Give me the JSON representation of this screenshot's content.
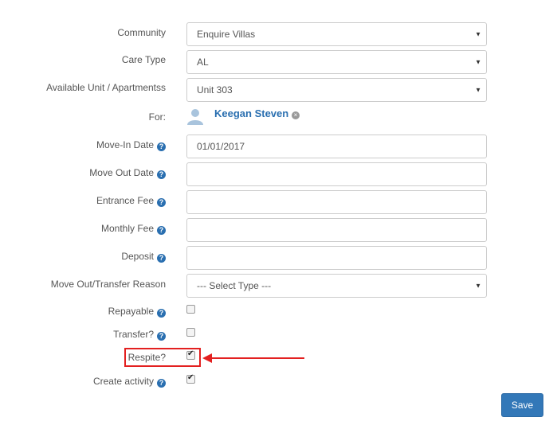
{
  "form": {
    "community": {
      "label": "Community",
      "value": "Enquire Villas"
    },
    "care_type": {
      "label": "Care Type",
      "value": "AL"
    },
    "unit": {
      "label": "Available Unit / Apartmentss",
      "value": "Unit 303"
    },
    "for": {
      "label": "For:",
      "name": "Keegan Steven"
    },
    "move_in_date": {
      "label": "Move-In Date",
      "value": "01/01/2017"
    },
    "move_out_date": {
      "label": "Move Out Date",
      "value": ""
    },
    "entrance_fee": {
      "label": "Entrance Fee",
      "value": ""
    },
    "monthly_fee": {
      "label": "Monthly Fee",
      "value": ""
    },
    "deposit": {
      "label": "Deposit",
      "value": ""
    },
    "move_out_reason": {
      "label": "Move Out/Transfer Reason",
      "value": "--- Select Type ---"
    },
    "repayable": {
      "label": "Repayable",
      "checked": false
    },
    "transfer": {
      "label": "Transfer?",
      "checked": false
    },
    "respite": {
      "label": "Respite?",
      "checked": true
    },
    "create_activity": {
      "label": "Create activity",
      "checked": true
    }
  },
  "actions": {
    "save_label": "Save"
  },
  "colors": {
    "link": "#2a6fb0",
    "primary_button": "#3378b8",
    "annotation": "#e32020"
  },
  "icons": {
    "help": "question-circle-icon",
    "person": "person-icon",
    "remove": "remove-x-icon",
    "caret": "caret-down-icon"
  }
}
